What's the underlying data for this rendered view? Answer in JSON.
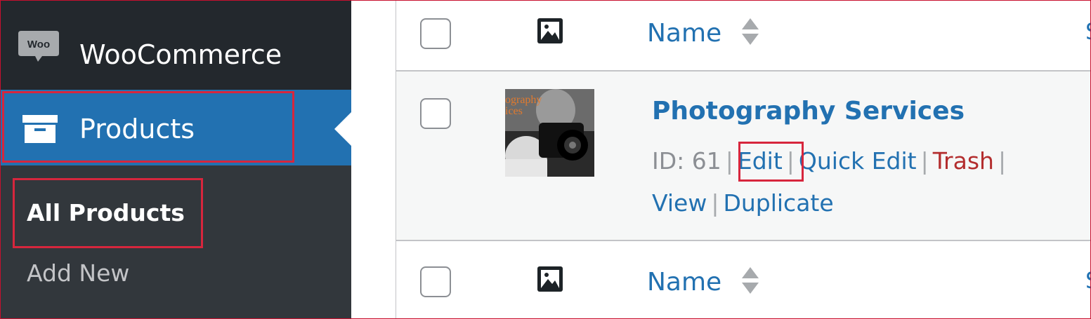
{
  "sidebar": {
    "brand_label": "WooCommerce",
    "brand_logo_text": "Woo",
    "menu_label": "Products",
    "submenu": {
      "all_products": "All Products",
      "add_new": "Add New"
    }
  },
  "table": {
    "header": {
      "name_label": "Name"
    },
    "footer": {
      "name_label": "Name"
    },
    "truncated_column_letter": "S",
    "product": {
      "thumbnail_text": "ography\nices",
      "title": "Photography Services",
      "id_text": "ID: 61",
      "actions": {
        "edit": "Edit",
        "quick_edit": "Quick Edit",
        "trash": "Trash",
        "view": "View",
        "duplicate": "Duplicate"
      }
    }
  },
  "colors": {
    "sidebar_bg": "#23282d",
    "submenu_bg": "#32373c",
    "active_blue": "#2271b1",
    "link_blue": "#2271b1",
    "trash_red": "#b32d2e",
    "highlight_red": "#d7263d"
  }
}
